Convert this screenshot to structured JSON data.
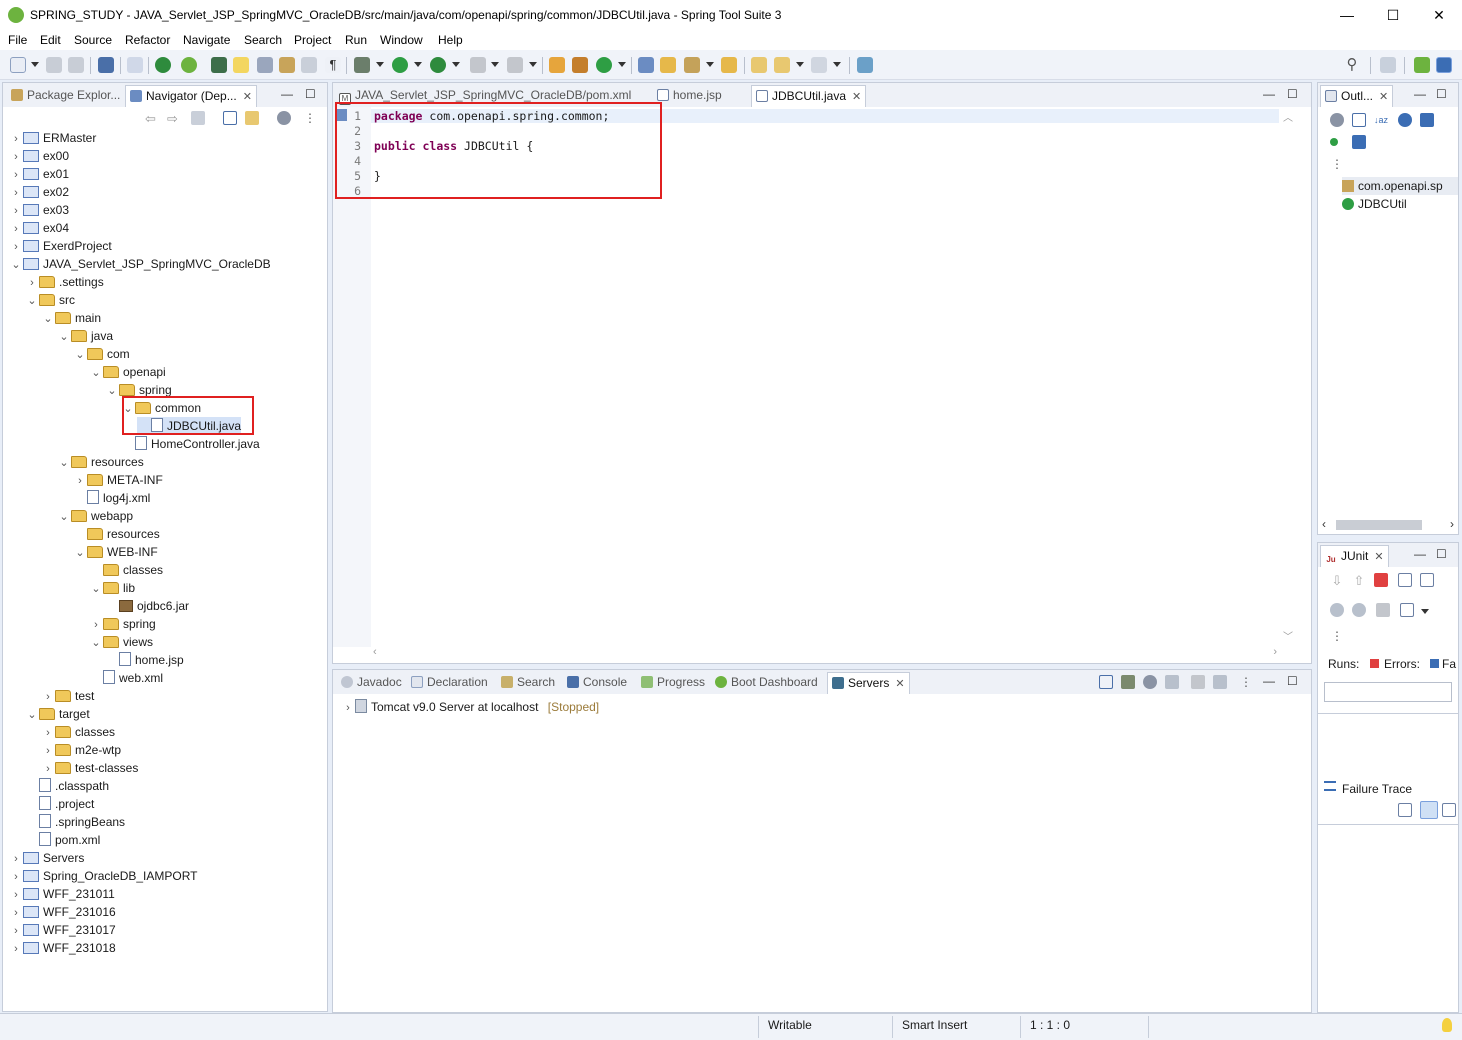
{
  "window": {
    "title": "SPRING_STUDY - JAVA_Servlet_JSP_SpringMVC_OracleDB/src/main/java/com/openapi/spring/common/JDBCUtil.java - Spring Tool Suite 3",
    "minimize": "—",
    "maximize": "☐",
    "close": "✕"
  },
  "menu": [
    "File",
    "Edit",
    "Source",
    "Refactor",
    "Navigate",
    "Search",
    "Project",
    "Run",
    "Window",
    "Help"
  ],
  "left_panel": {
    "tabs": [
      {
        "label": "Package Explor...",
        "active": false
      },
      {
        "label": "Navigator (Dep...",
        "active": true
      }
    ],
    "tree": [
      {
        "label": "ERMaster",
        "level": 0,
        "expanded": false,
        "icon": "project-icon"
      },
      {
        "label": "ex00",
        "level": 0,
        "expanded": false,
        "icon": "spring-project-icon"
      },
      {
        "label": "ex01",
        "level": 0,
        "expanded": false,
        "icon": "spring-project-icon"
      },
      {
        "label": "ex02",
        "level": 0,
        "expanded": false,
        "icon": "spring-project-icon"
      },
      {
        "label": "ex03",
        "level": 0,
        "expanded": false,
        "icon": "spring-project-icon"
      },
      {
        "label": "ex04",
        "level": 0,
        "expanded": false,
        "icon": "spring-project-icon"
      },
      {
        "label": "ExerdProject",
        "level": 0,
        "expanded": false,
        "icon": "project-icon"
      },
      {
        "label": "JAVA_Servlet_JSP_SpringMVC_OracleDB",
        "level": 0,
        "expanded": true,
        "icon": "spring-project-icon"
      },
      {
        "label": ".settings",
        "level": 1,
        "expanded": false,
        "icon": "folder-icon"
      },
      {
        "label": "src",
        "level": 1,
        "expanded": true,
        "icon": "folder-icon"
      },
      {
        "label": "main",
        "level": 2,
        "expanded": true,
        "icon": "folder-icon"
      },
      {
        "label": "java",
        "level": 3,
        "expanded": true,
        "icon": "folder-icon"
      },
      {
        "label": "com",
        "level": 4,
        "expanded": true,
        "icon": "folder-icon"
      },
      {
        "label": "openapi",
        "level": 5,
        "expanded": true,
        "icon": "folder-icon"
      },
      {
        "label": "spring",
        "level": 6,
        "expanded": true,
        "icon": "folder-icon"
      },
      {
        "label": "common",
        "level": 7,
        "expanded": true,
        "icon": "folder-icon"
      },
      {
        "label": "JDBCUtil.java",
        "level": 8,
        "expanded": null,
        "icon": "java-file-icon",
        "selected": true
      },
      {
        "label": "HomeController.java",
        "level": 7,
        "expanded": null,
        "icon": "java-file-icon"
      },
      {
        "label": "resources",
        "level": 3,
        "expanded": true,
        "icon": "folder-icon"
      },
      {
        "label": "META-INF",
        "level": 4,
        "expanded": false,
        "icon": "folder-icon"
      },
      {
        "label": "log4j.xml",
        "level": 4,
        "expanded": null,
        "icon": "xml-file-icon"
      },
      {
        "label": "webapp",
        "level": 3,
        "expanded": true,
        "icon": "folder-icon"
      },
      {
        "label": "resources",
        "level": 4,
        "expanded": null,
        "icon": "folder-icon"
      },
      {
        "label": "WEB-INF",
        "level": 4,
        "expanded": true,
        "icon": "folder-icon"
      },
      {
        "label": "classes",
        "level": 5,
        "expanded": null,
        "icon": "folder-icon"
      },
      {
        "label": "lib",
        "level": 5,
        "expanded": true,
        "icon": "folder-icon"
      },
      {
        "label": "ojdbc6.jar",
        "level": 6,
        "expanded": null,
        "icon": "jar-icon"
      },
      {
        "label": "spring",
        "level": 5,
        "expanded": false,
        "icon": "folder-icon"
      },
      {
        "label": "views",
        "level": 5,
        "expanded": true,
        "icon": "folder-icon"
      },
      {
        "label": "home.jsp",
        "level": 6,
        "expanded": null,
        "icon": "file-icon"
      },
      {
        "label": "web.xml",
        "level": 5,
        "expanded": null,
        "icon": "xml-file-icon"
      },
      {
        "label": "test",
        "level": 2,
        "expanded": false,
        "icon": "folder-icon"
      },
      {
        "label": "target",
        "level": 1,
        "expanded": true,
        "icon": "folder-icon"
      },
      {
        "label": "classes",
        "level": 2,
        "expanded": false,
        "icon": "folder-icon"
      },
      {
        "label": "m2e-wtp",
        "level": 2,
        "expanded": false,
        "icon": "folder-icon"
      },
      {
        "label": "test-classes",
        "level": 2,
        "expanded": false,
        "icon": "folder-icon"
      },
      {
        "label": ".classpath",
        "level": 1,
        "expanded": null,
        "icon": "xml-file-icon"
      },
      {
        "label": ".project",
        "level": 1,
        "expanded": null,
        "icon": "xml-file-icon"
      },
      {
        "label": ".springBeans",
        "level": 1,
        "expanded": null,
        "icon": "file-icon"
      },
      {
        "label": "pom.xml",
        "level": 1,
        "expanded": null,
        "icon": "file-icon"
      },
      {
        "label": "Servers",
        "level": 0,
        "expanded": false,
        "icon": "project-icon"
      },
      {
        "label": "Spring_OracleDB_IAMPORT",
        "level": 0,
        "expanded": false,
        "icon": "spring-project-icon"
      },
      {
        "label": "WFF_231011",
        "level": 0,
        "expanded": false,
        "icon": "spring-project-icon"
      },
      {
        "label": "WFF_231016",
        "level": 0,
        "expanded": false,
        "icon": "spring-project-icon"
      },
      {
        "label": "WFF_231017",
        "level": 0,
        "expanded": false,
        "icon": "spring-project-icon"
      },
      {
        "label": "WFF_231018",
        "level": 0,
        "expanded": false,
        "icon": "spring-project-icon"
      }
    ]
  },
  "editor": {
    "tabs": [
      {
        "label": "JAVA_Servlet_JSP_SpringMVC_OracleDB/pom.xml",
        "active": false
      },
      {
        "label": "home.jsp",
        "active": false
      },
      {
        "label": "JDBCUtil.java",
        "active": true
      }
    ],
    "lines": [
      {
        "n": "1",
        "text": "package com.openapi.spring.common;"
      },
      {
        "n": "2",
        "text": ""
      },
      {
        "n": "3",
        "text": "public class JDBCUtil {"
      },
      {
        "n": "4",
        "text": ""
      },
      {
        "n": "5",
        "text": "}"
      },
      {
        "n": "6",
        "text": ""
      }
    ]
  },
  "outline": {
    "tab_label": "Outl...",
    "items": [
      "com.openapi.sp",
      "JDBCUtil"
    ]
  },
  "junit": {
    "tab_label": "JUnit",
    "runs_label": "Runs:",
    "errors_label": "Errors:",
    "failures_label": "Fa",
    "failure_trace_label": "Failure Trace"
  },
  "bottom_panel": {
    "tabs": [
      "Javadoc",
      "Declaration",
      "Search",
      "Console",
      "Progress",
      "Boot Dashboard",
      "Servers"
    ],
    "active_tab": "Servers",
    "server": {
      "name": "Tomcat v9.0 Server at localhost",
      "status": "[Stopped]"
    }
  },
  "status_bar": {
    "writable": "Writable",
    "insert_mode": "Smart Insert",
    "position": "1 : 1 : 0"
  },
  "colors": {
    "accent_red": "#e02020",
    "keyword": "#7f0055",
    "status_stopped": "#9b7b3a"
  }
}
